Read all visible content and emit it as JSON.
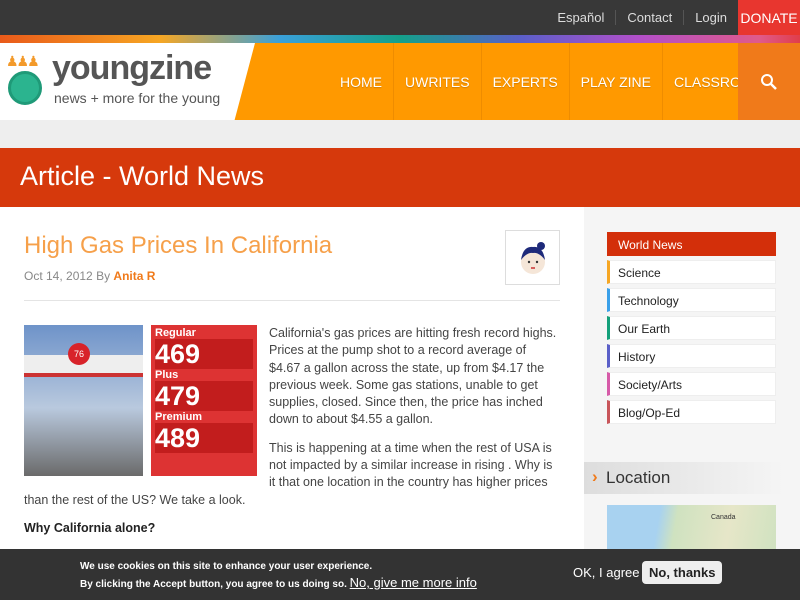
{
  "topbar": {
    "links": [
      "Español",
      "Contact",
      "Login"
    ],
    "donate": "DONATE"
  },
  "logo": {
    "name_a": "young",
    "name_b": "zine",
    "tagline": "news + more for the young"
  },
  "nav": [
    "HOME",
    "UWRITES",
    "EXPERTS",
    "PLAY ZINE",
    "CLASSROOM"
  ],
  "banner": "Article - World News",
  "article": {
    "title": "High Gas Prices In California",
    "date": "Oct 14, 2012",
    "by": "By",
    "author": "Anita R",
    "photo": {
      "brand": "76",
      "labels": [
        "Regular",
        "Plus",
        "Premium"
      ],
      "prices": [
        "469",
        "479",
        "489"
      ]
    },
    "paragraphs": [
      "California's gas prices are hitting fresh record highs. Prices at the pump shot to a record average of $4.67 a gallon across the state, up from $4.17 the previous week. Some gas stations, unable to get supplies, closed. Since then, the price has inched down to about $4.55 a gallon.",
      "This is happening at a time when the rest of USA is not impacted by a similar increase in rising . Why is it that one location in the country has higher prices than the rest of the US? We take a look."
    ],
    "subheading": "Why California alone?"
  },
  "sidebar": {
    "categories": [
      {
        "label": "World News",
        "color": "#d32f0a"
      },
      {
        "label": "Science",
        "color": "#f6a623"
      },
      {
        "label": "Technology",
        "color": "#3aa0e9"
      },
      {
        "label": "Our Earth",
        "color": "#14a07a"
      },
      {
        "label": "History",
        "color": "#5a5fc8"
      },
      {
        "label": "Society/Arts",
        "color": "#d65aa8"
      },
      {
        "label": "Blog/Op-Ed",
        "color": "#c8555a"
      }
    ],
    "location_title": "Location",
    "map_label": "Canada"
  },
  "cookie": {
    "line1": "We use cookies on this site to enhance your user experience.",
    "line2": "By clicking the Accept button, you agree to us doing so.",
    "more": "No, give me more info",
    "agree": "OK, I agree",
    "decline": "No, thanks"
  }
}
